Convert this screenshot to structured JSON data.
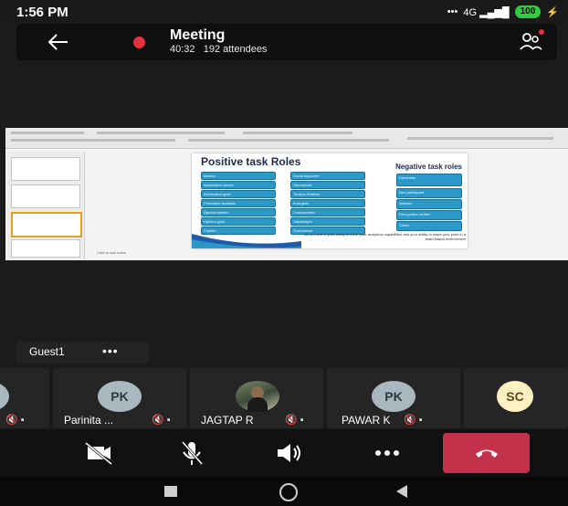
{
  "status_bar": {
    "time": "1:56 PM",
    "signal": "4G",
    "battery": "100"
  },
  "header": {
    "title": "Meeting",
    "duration": "40:32",
    "attendees": "192 attendees"
  },
  "shared_slide": {
    "title": "Positive task Roles",
    "negative_title": "Negative task roles",
    "positive_roles": [
      "Initiator",
      "Information seeker",
      "Information giver",
      "Procedure facilitator",
      "Opinion seeker",
      "Opinion giver",
      "Clarifier"
    ],
    "middle_roles": [
      "Social supporter",
      "Harmonizer",
      "Tension Reliever",
      "Energizer",
      "Compromiser",
      "Gatekeeper",
      "Summarizer"
    ],
    "negative_roles": [
      "Dominator",
      "Non-participant",
      "Attacker",
      "Recognition seeker",
      "Clown"
    ],
    "quote": "GD is a test of your ability to think, your analytical capabilities and your ability to make your point in a team-based environment",
    "notes_placeholder": "Click to add notes"
  },
  "guest": {
    "name": "Guest1",
    "more": "•••"
  },
  "participants": [
    {
      "initials": "",
      "name": ""
    },
    {
      "initials": "PK",
      "name": "Parinita ..."
    },
    {
      "initials": "",
      "name": "JAGTAP R"
    },
    {
      "initials": "PK",
      "name": "PAWAR K"
    },
    {
      "initials": "SC",
      "name": ""
    }
  ],
  "colors": {
    "end_call": "#c4314b",
    "recording": "#e0313f",
    "slide_tag": "#2a98c8"
  }
}
